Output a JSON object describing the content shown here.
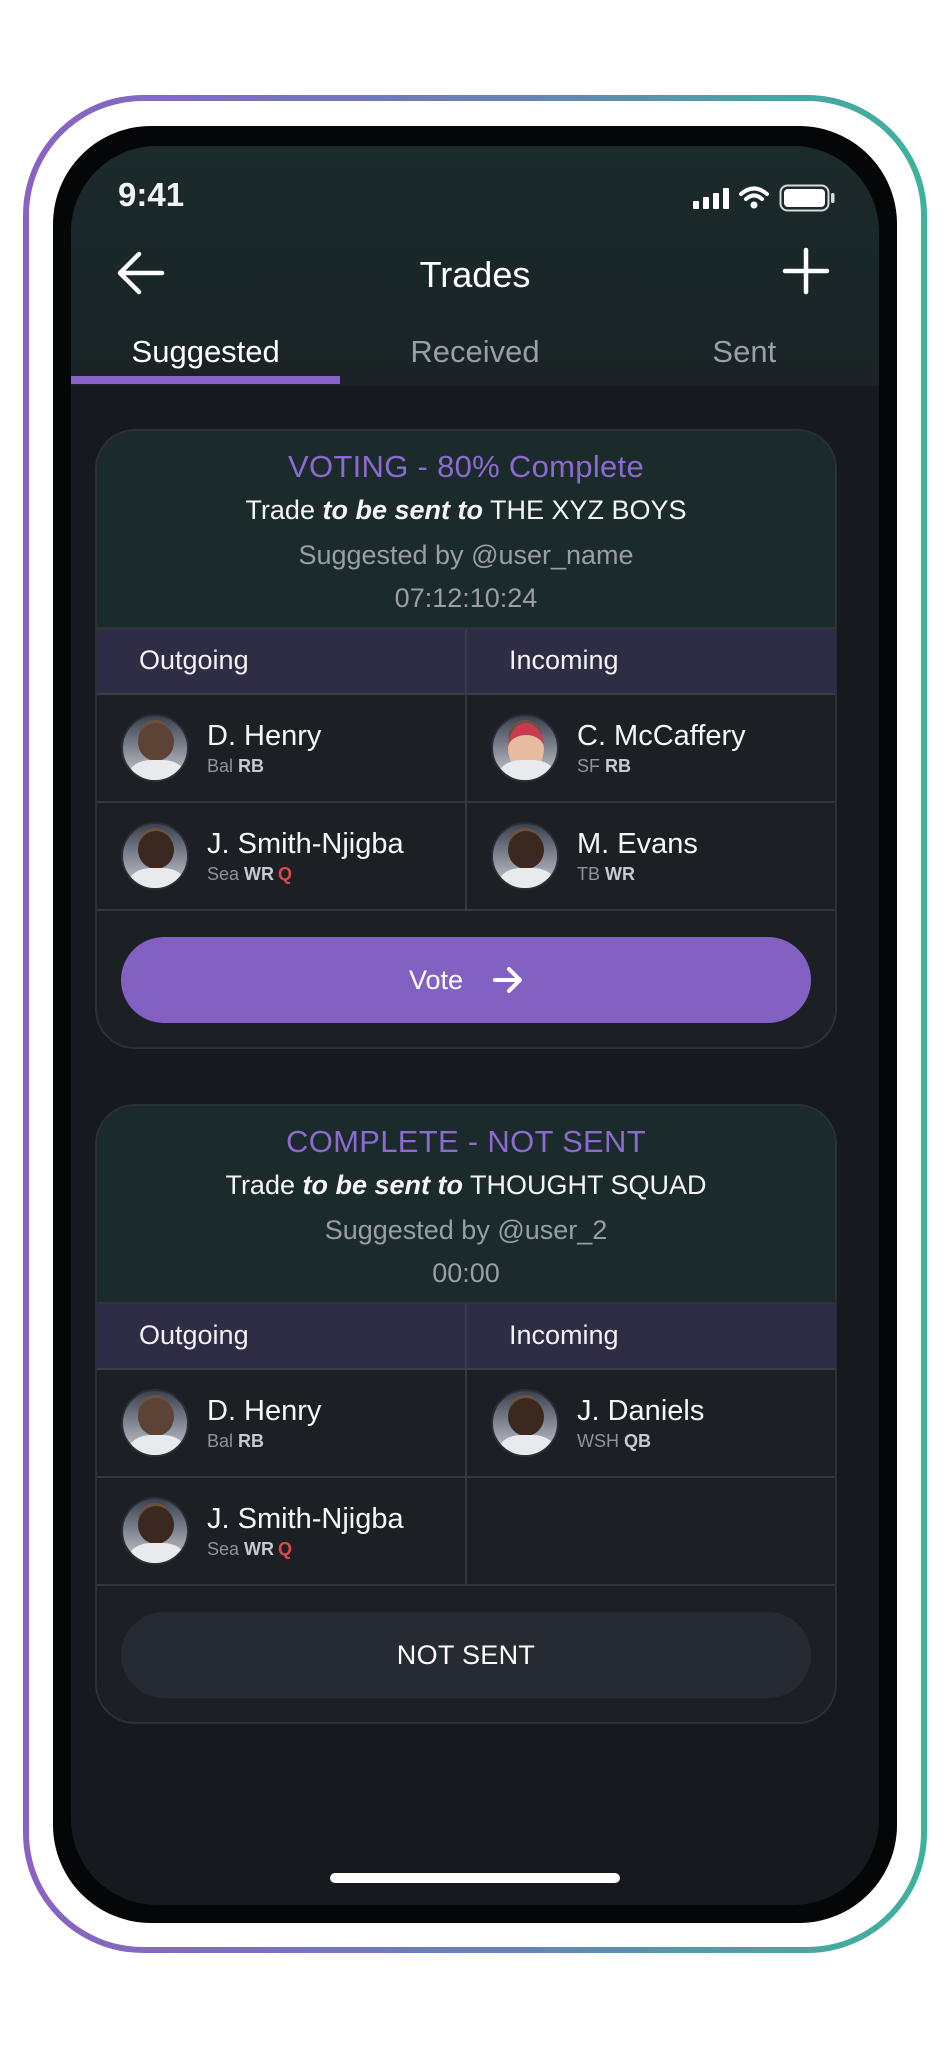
{
  "status_bar": {
    "time": "9:41"
  },
  "header": {
    "title": "Trades"
  },
  "tabs": [
    {
      "label": "Suggested",
      "active": true
    },
    {
      "label": "Received",
      "active": false
    },
    {
      "label": "Sent",
      "active": false
    }
  ],
  "cards": [
    {
      "status": "VOTING - 80% Complete",
      "trade_prefix": "Trade ",
      "trade_emphasis": "to be sent to",
      "trade_team": " THE XYZ BOYS",
      "suggested_by": "Suggested by @user_name",
      "timer": "07:12:10:24",
      "outgoing_label": "Outgoing",
      "incoming_label": "Incoming",
      "rows": [
        {
          "out": {
            "name": "D. Henry",
            "team": "Bal",
            "pos": "RB",
            "tag": ""
          },
          "in": {
            "name": "C. McCaffery",
            "team": "SF",
            "pos": "RB",
            "tag": ""
          }
        },
        {
          "out": {
            "name": "J. Smith-Njigba",
            "team": "Sea",
            "pos": "WR",
            "tag": "Q"
          },
          "in": {
            "name": "M. Evans",
            "team": "TB",
            "pos": "WR",
            "tag": ""
          }
        }
      ],
      "action_label": "Vote"
    },
    {
      "status": "COMPLETE - NOT SENT",
      "trade_prefix": "Trade ",
      "trade_emphasis": "to be sent to",
      "trade_team": " THOUGHT SQUAD",
      "suggested_by": "Suggested by @user_2",
      "timer": "00:00",
      "outgoing_label": "Outgoing",
      "incoming_label": "Incoming",
      "rows": [
        {
          "out": {
            "name": "D. Henry",
            "team": "Bal",
            "pos": "RB",
            "tag": ""
          },
          "in": {
            "name": "J. Daniels",
            "team": "WSH",
            "pos": "QB",
            "tag": ""
          }
        },
        {
          "out": {
            "name": "J. Smith-Njigba",
            "team": "Sea",
            "pos": "WR",
            "tag": "Q"
          }
        }
      ],
      "action_label": "NOT SENT"
    }
  ],
  "colors": {
    "accent": "#8261c3",
    "status_purple": "#8d6ad0",
    "injury_red": "#e2474f",
    "frame_gradient_start": "#8a62c4",
    "frame_gradient_end": "#3db39b"
  }
}
